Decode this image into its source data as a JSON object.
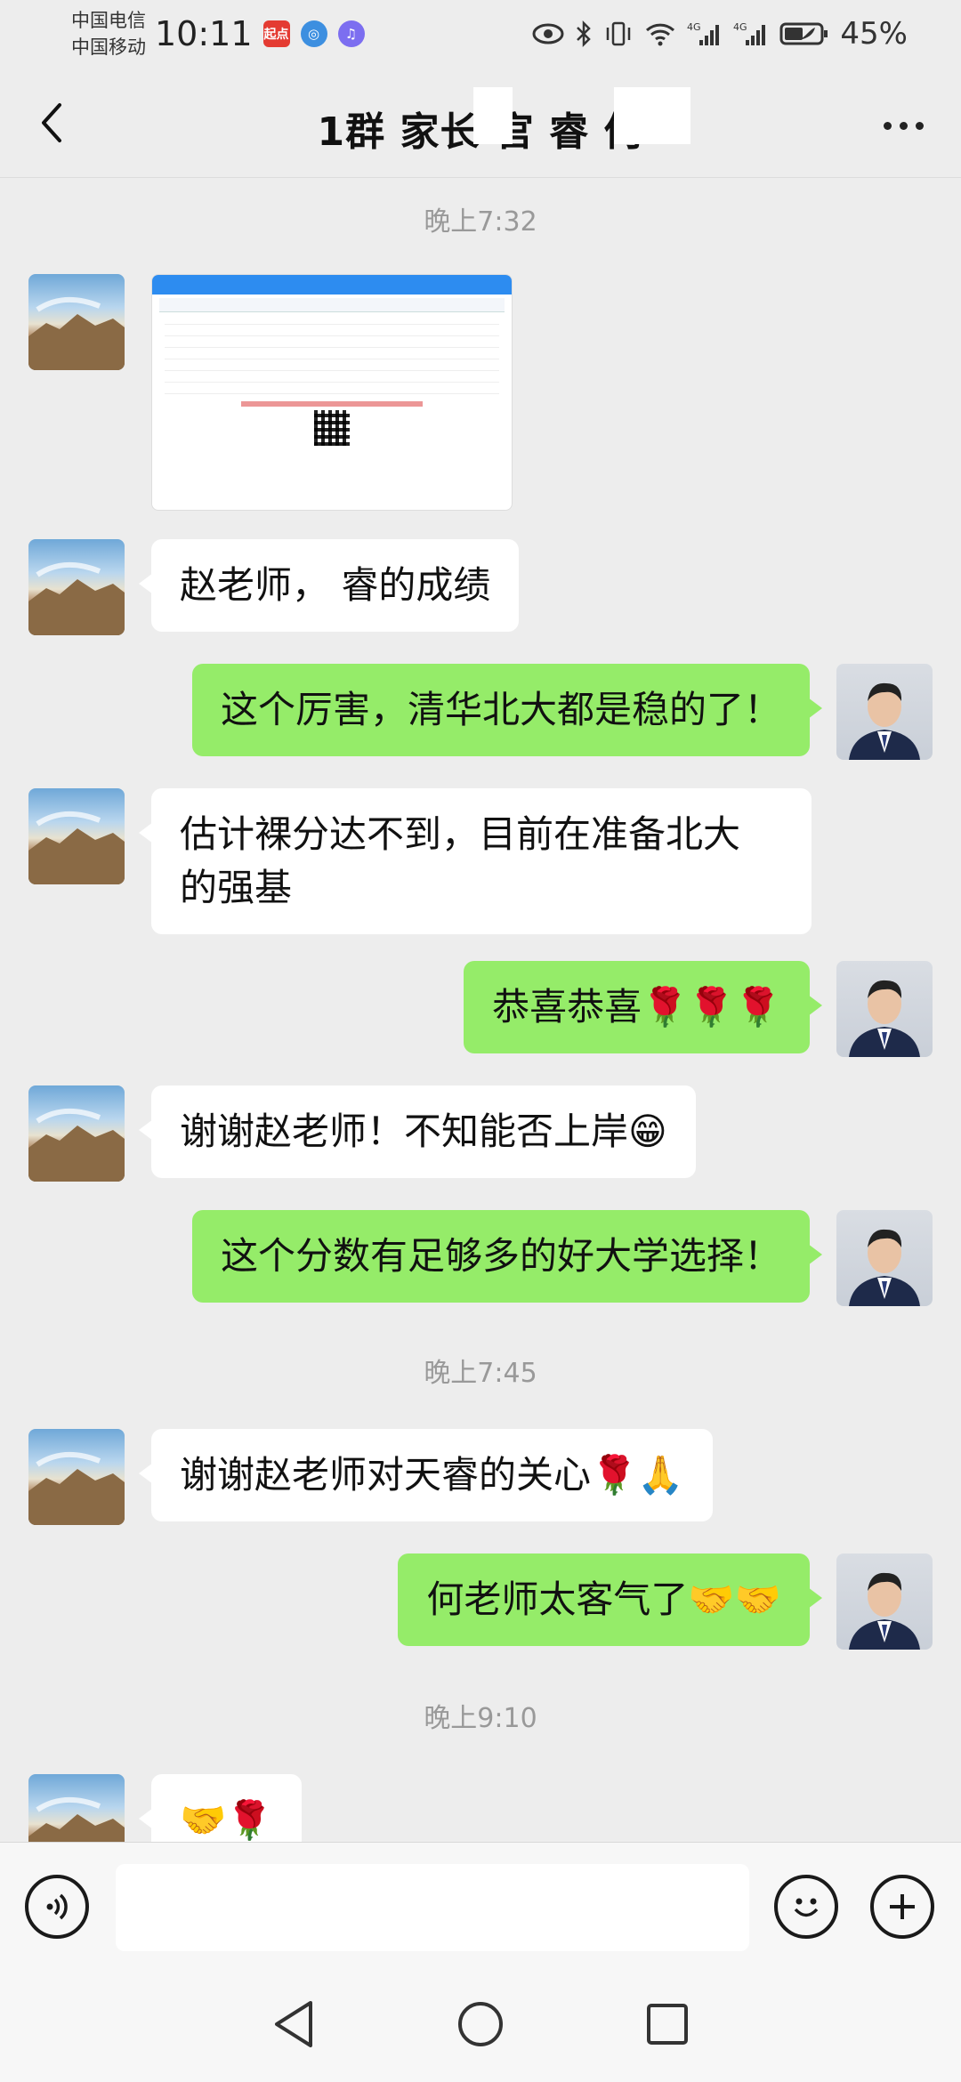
{
  "status": {
    "carrier1": "中国电信",
    "carrier2": "中国移动",
    "time": "10:11",
    "app1": "起点",
    "net1": "4G",
    "net2": "4G",
    "battery": "45%"
  },
  "header": {
    "title": "1群 家长 官  睿 何"
  },
  "messages": {
    "t1": "晚上7:32",
    "m2": "赵老师，  睿的成绩",
    "m3": "这个厉害，清华北大都是稳的了！",
    "m4a": "估计裸分达不到，目前在准备北大",
    "m4b": "的强基",
    "m5": "恭喜恭喜",
    "m5e": "🌹🌹🌹",
    "m6": "谢谢赵老师！不知能否上岸",
    "m6e": "😁",
    "m7": "这个分数有足够多的好大学选择！",
    "t2": "晚上7:45",
    "m8": "谢谢赵老师对天睿的关心",
    "m8e": "🌹🙏",
    "m9": "何老师太客气了",
    "m9e": "🤝🤝",
    "t3": "晚上9:10",
    "m10e": "🤝🌹"
  },
  "input": {
    "value": ""
  },
  "icons": {
    "back": "back-arrow-icon",
    "more": "more-dots-icon",
    "voice": "voice-icon",
    "emoji": "emoji-icon",
    "plus": "plus-icon"
  }
}
